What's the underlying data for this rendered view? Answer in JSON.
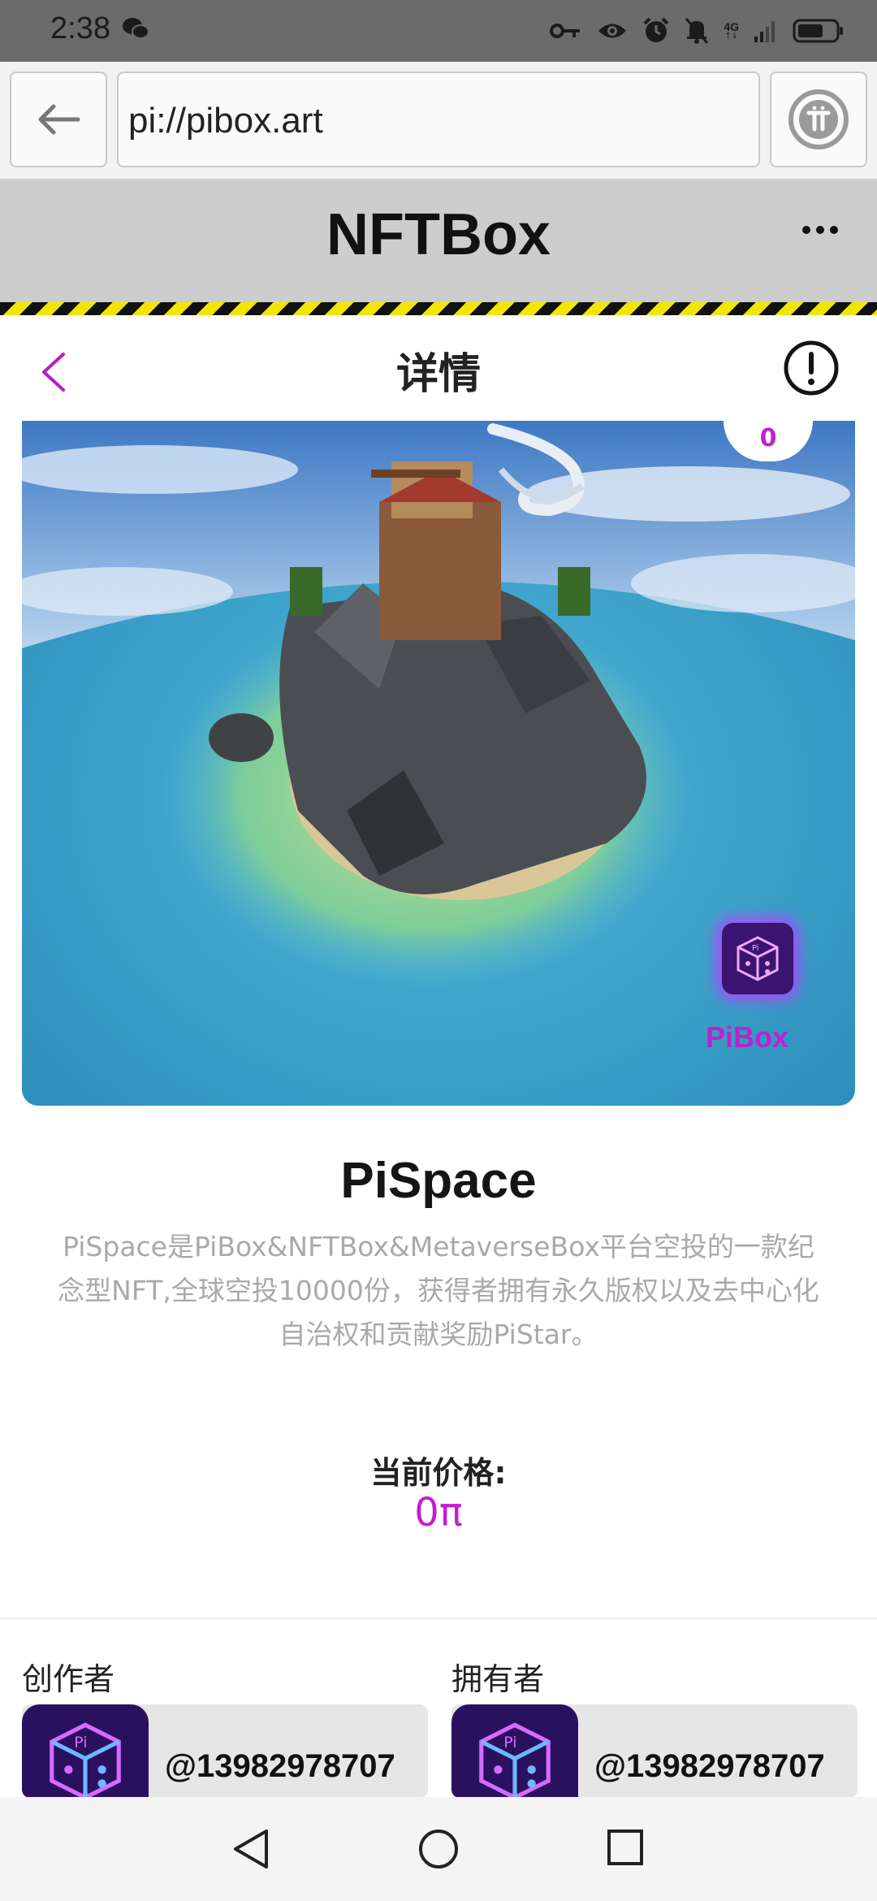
{
  "status_bar": {
    "time": "2:38",
    "network": "4G",
    "icons": [
      "wechat-icon",
      "key-icon",
      "eye-icon",
      "alarm-icon",
      "mute-icon",
      "signal-icon",
      "battery-icon"
    ]
  },
  "browser": {
    "url": "pi://pibox.art"
  },
  "app": {
    "title": "NFTBox"
  },
  "page": {
    "title": "详情"
  },
  "hero": {
    "like_count": "0",
    "brand_label": "PiBox"
  },
  "nft": {
    "name": "PiSpace",
    "description": "PiSpace是PiBox&NFTBox&MetaverseBox平台空投的一款纪念型NFT,全球空投10000份，获得者拥有永久版权以及去中心化自治权和贡献奖励PiStar。",
    "price_label": "当前价格:",
    "price_value": "0π"
  },
  "creator": {
    "label": "创作者",
    "handle": "@13982978707"
  },
  "owner": {
    "label": "拥有者",
    "handle": "@13982978707"
  },
  "colors": {
    "accent": "#c21fcf",
    "header_bg": "#cdcdcd",
    "hazard_yellow": "#f2e600"
  }
}
